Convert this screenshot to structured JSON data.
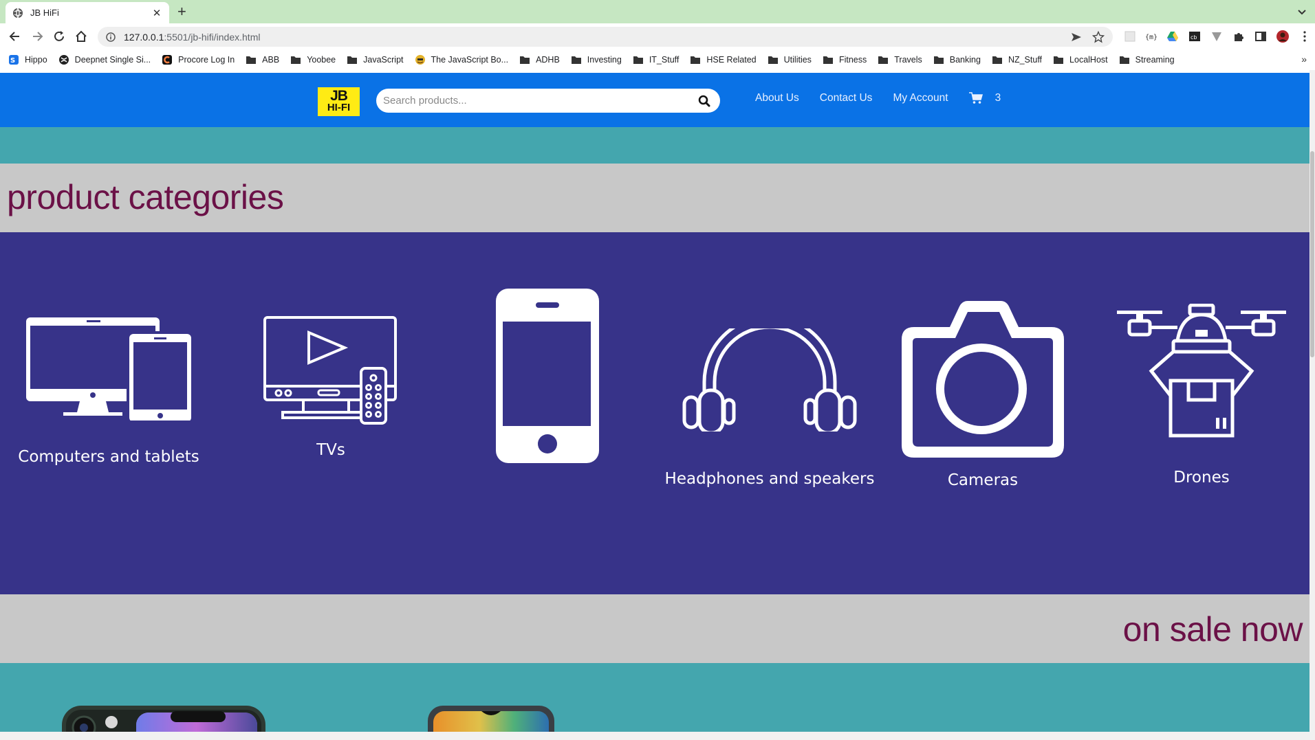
{
  "browser": {
    "tab_title": "JB HiFi",
    "url_host": "127.0.0.1",
    "url_rest": ":5501/jb-hifi/index.html",
    "bookmarks": [
      {
        "label": "Hippo",
        "icon": "hippo-icon"
      },
      {
        "label": "Deepnet Single Si...",
        "icon": "globe-icon"
      },
      {
        "label": "Procore Log In",
        "icon": "procore-icon"
      },
      {
        "label": "ABB",
        "icon": "folder-icon"
      },
      {
        "label": "Yoobee",
        "icon": "folder-icon"
      },
      {
        "label": "JavaScript",
        "icon": "folder-icon"
      },
      {
        "label": "The JavaScript Bo...",
        "icon": "book-icon"
      },
      {
        "label": "ADHB",
        "icon": "folder-icon"
      },
      {
        "label": "Investing",
        "icon": "folder-icon"
      },
      {
        "label": "IT_Stuff",
        "icon": "folder-icon"
      },
      {
        "label": "HSE Related",
        "icon": "folder-icon"
      },
      {
        "label": "Utilities",
        "icon": "folder-icon"
      },
      {
        "label": "Fitness",
        "icon": "folder-icon"
      },
      {
        "label": "Travels",
        "icon": "folder-icon"
      },
      {
        "label": "Banking",
        "icon": "folder-icon"
      },
      {
        "label": "NZ_Stuff",
        "icon": "folder-icon"
      },
      {
        "label": "LocalHost",
        "icon": "folder-icon"
      },
      {
        "label": "Streaming",
        "icon": "folder-icon"
      }
    ],
    "bookmarks_more": "»"
  },
  "header": {
    "logo_line1": "JB",
    "logo_line2": "HI-FI",
    "search_placeholder": "Search products...",
    "nav": [
      "About Us",
      "Contact Us",
      "My Account"
    ],
    "cart_count": "3"
  },
  "colors": {
    "header_blue": "#0a72e6",
    "logo_yellow": "#ffeb14",
    "teal": "#44a6ae",
    "gray": "#c8c8c8",
    "categories_bg": "#373389",
    "title_color": "#6b1147"
  },
  "sections": {
    "categories_title": "product categories",
    "sale_title": "on sale now"
  },
  "categories": [
    {
      "label": "Computers and tablets",
      "icon": "computer-tablet-icon"
    },
    {
      "label": "TVs",
      "icon": "tv-icon"
    },
    {
      "label": "",
      "icon": "smartphone-icon"
    },
    {
      "label": "Headphones and speakers",
      "icon": "headphones-icon"
    },
    {
      "label": "Cameras",
      "icon": "camera-icon"
    },
    {
      "label": "Drones",
      "icon": "drone-icon"
    }
  ]
}
